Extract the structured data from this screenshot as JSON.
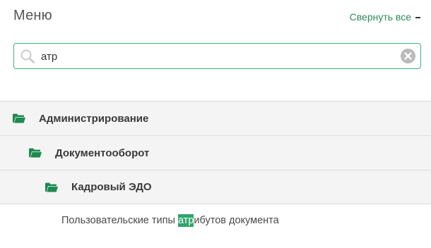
{
  "header": {
    "title": "Меню",
    "collapse_all_label": "Свернуть все"
  },
  "search": {
    "value": "атр",
    "placeholder": ""
  },
  "tree": [
    {
      "label": "Администрирование",
      "icon": "folder-open-icon",
      "level": 0
    },
    {
      "label": "Документооборот",
      "icon": "folder-open-icon",
      "level": 1
    },
    {
      "label": "Кадровый ЭДО",
      "icon": "folder-open-icon",
      "level": 2
    }
  ],
  "leaf": {
    "before": "Пользовательские типы ",
    "match": "атр",
    "after": "ибутов документа"
  },
  "colors": {
    "accent": "#2fa56a",
    "link": "#2e8b57",
    "row_bg": "#f4f4f4"
  }
}
